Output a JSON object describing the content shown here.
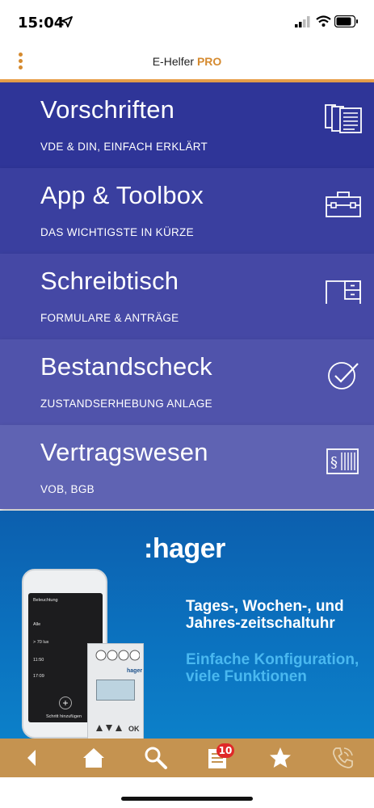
{
  "status_bar": {
    "time": "15:04"
  },
  "header": {
    "title_prefix": "E-Helfer ",
    "title_suffix": "PRO",
    "accent": "#d58a2f"
  },
  "menu": {
    "items": [
      {
        "title": "Vorschriften",
        "subtitle": "VDE & DIN, EINFACH ERKLÄRT",
        "icon": "documents-icon"
      },
      {
        "title": "App & Toolbox",
        "subtitle": "DAS WICHTIGSTE IN KÜRZE",
        "icon": "toolbox-icon"
      },
      {
        "title": "Schreibtisch",
        "subtitle": "FORMULARE & ANTRÄGE",
        "icon": "desk-icon"
      },
      {
        "title": "Bestandscheck",
        "subtitle": "ZUSTANDSERHEBUNG ANLAGE",
        "icon": "check-circle-icon"
      },
      {
        "title": "Vertragswesen",
        "subtitle": "VOB, BGB",
        "icon": "paragraph-icon"
      }
    ]
  },
  "banner": {
    "brand": ":hager",
    "headline": "Tages-, Wochen-, und Jahres-zeitschaltuhr",
    "subline": "Einfache Konfiguration, viele Funktionen",
    "phone": {
      "title": "Beleuchtung",
      "row1": "Alle",
      "row2": "> 70 lux",
      "row3": "11:50",
      "row4": "17:09",
      "button": "Schritt hinzufügen"
    },
    "device": {
      "brand": "hager",
      "ok": "OK"
    }
  },
  "tabbar": {
    "items": [
      "back-icon",
      "home-icon",
      "search-icon",
      "news-icon",
      "star-icon",
      "phone-icon"
    ],
    "badge_count": "10"
  }
}
